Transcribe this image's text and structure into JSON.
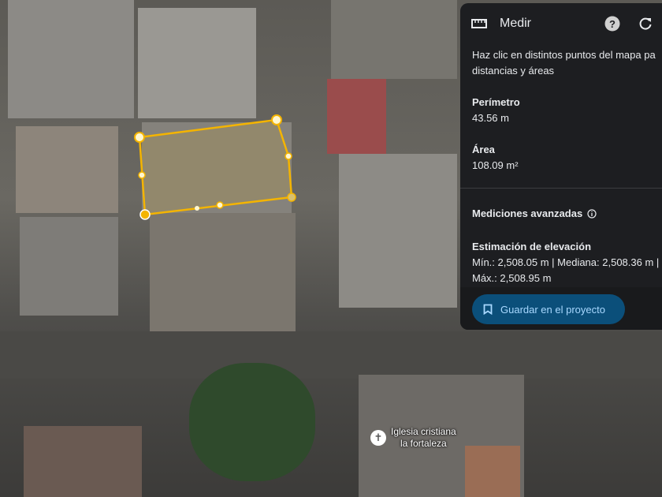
{
  "panel": {
    "title": "Medir",
    "description_line1": "Haz clic en distintos puntos del mapa pa",
    "description_line2": "distancias y áreas",
    "perimeter_label": "Perímetro",
    "perimeter_value": "43.56 m",
    "area_label": "Área",
    "area_value": "108.09 m²",
    "advanced_label": "Mediciones avanzadas",
    "elevation_label": "Estimación de elevación",
    "elevation_line1": "Mín.: 2,508.05 m | Mediana: 2,508.36 m |",
    "elevation_line2": "Máx.: 2,508.95 m",
    "save_label": "Guardar en el proyecto"
  },
  "map": {
    "place_line1": "Iglesia cristiana",
    "place_line2": "la fortaleza",
    "measure_color": "#f4b400"
  }
}
